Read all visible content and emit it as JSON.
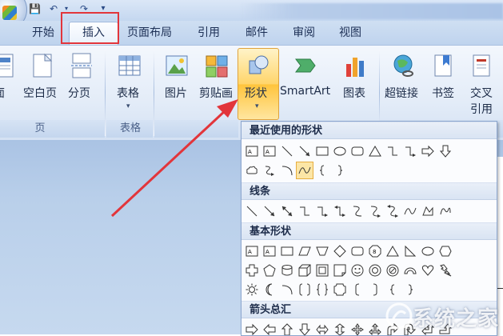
{
  "tabs": [
    {
      "label": "开始"
    },
    {
      "label": "插入"
    },
    {
      "label": "页面布局"
    },
    {
      "label": "引用"
    },
    {
      "label": "邮件"
    },
    {
      "label": "审阅"
    },
    {
      "label": "视图"
    }
  ],
  "ribbon": {
    "pages_group": {
      "name": "页",
      "cover_label": "面",
      "blank_label": "空白页",
      "break_label": "分页"
    },
    "table_group": {
      "name": "表格",
      "table_label": "表格"
    },
    "illus_group": {
      "picture_label": "图片",
      "clipart_label": "剪贴画",
      "shapes_label": "形状",
      "smartart_label": "SmartArt",
      "chart_label": "图表"
    },
    "links_group": {
      "hyperlink_label": "超链接",
      "bookmark_label": "书签",
      "crossref_label_1": "交叉",
      "crossref_label_2": "引用"
    }
  },
  "shapes_menu": {
    "recent_header": "最近使用的形状",
    "lines_header": "线条",
    "basic_header": "基本形状",
    "arrows_header": "箭头总汇"
  },
  "watermark": {
    "text": "系统之家"
  },
  "colors": {
    "annotation_red": "#e2353b",
    "ribbon_blue": "#d4e1f3",
    "highlight": "#ffd56b"
  }
}
